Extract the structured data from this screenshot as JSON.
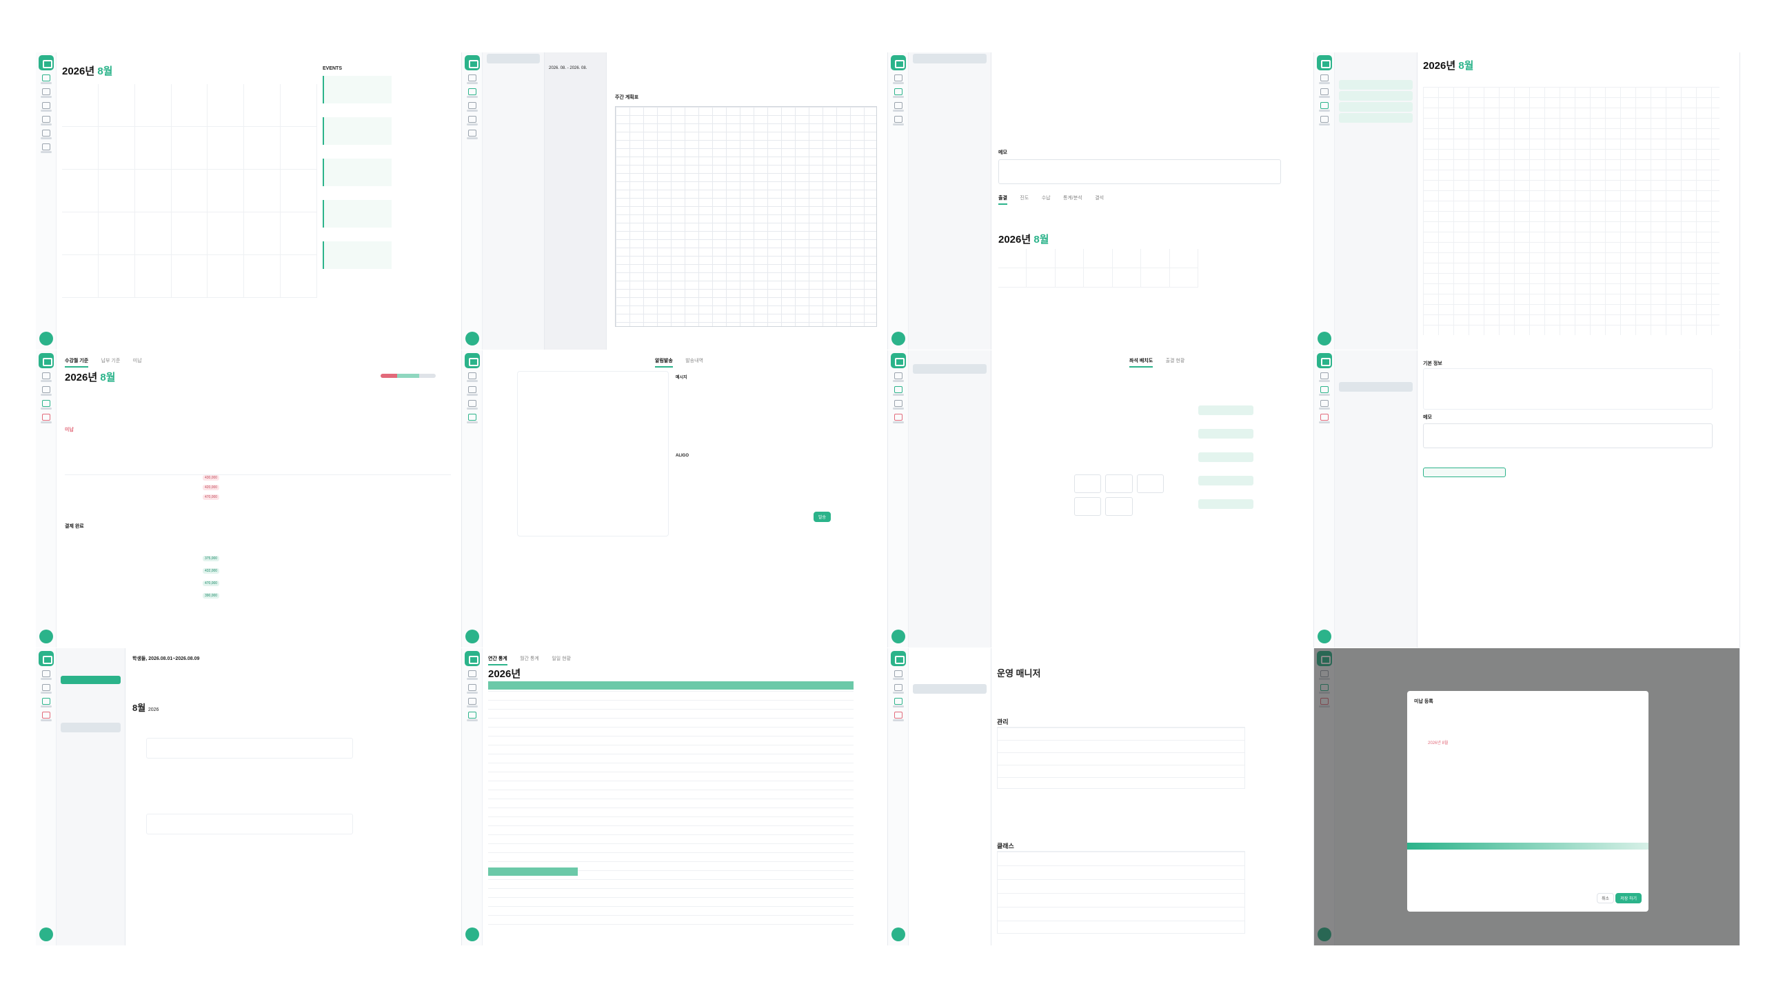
{
  "calendar": {
    "year_label": "2026년",
    "month_label": "8월",
    "events_header": "EVENTS"
  },
  "tuition": {
    "tab_active": "수강월 기준",
    "tab_2": "납부 기준",
    "tab_3": "미납",
    "year_label": "2026년",
    "month_label": "8월",
    "section_unpaid": "미납",
    "section_paid": "결제 완료",
    "amounts": [
      "430,000",
      "420,000",
      "470,000",
      "375,000",
      "432,000",
      "470,000",
      "390,000"
    ]
  },
  "weekly_plan": {
    "title": "주간 계획표",
    "date_range": "2026. 08. - 2026. 08."
  },
  "students_detail": {
    "year_label": "2026년",
    "month_label": "8월",
    "memo_label": "메모",
    "tabs": [
      "출결",
      "진도",
      "수납",
      "통계/분석",
      "결석"
    ]
  },
  "timetable": {
    "year_label": "2026년",
    "month_label": "8월"
  },
  "message": {
    "tab_1": "알림발송",
    "tab_2": "발송내역",
    "preview_label": "메시지",
    "algo_label": "ALIGO",
    "send_button": "발송"
  },
  "seating": {
    "tab_1": "좌석 배치도",
    "tab_2": "출결 현황"
  },
  "student_profile": {
    "section_basic": "기본 정보",
    "memo_label": "메모"
  },
  "daily_log": {
    "header": "학생들, 2026.08.01~2026.08.09",
    "month_label": "8월",
    "year_small": "2026"
  },
  "annual_stats": {
    "tabs": [
      "연간 통계",
      "월간 통계",
      "일일 현황"
    ],
    "year_label": "2026년"
  },
  "management": {
    "title": "운영 매니저",
    "section_1": "관리",
    "section_2": "클래스"
  },
  "unpaid_modal": {
    "title": "미납 등록",
    "confirm_button": "저장 하기",
    "cancel_button": "취소",
    "red_text": "2026년 8월"
  },
  "colors": {
    "accent": "#2bb38a",
    "accent_light": "#e3f4ee",
    "alert": "#e26a7a",
    "warning": "#f0a55a"
  }
}
